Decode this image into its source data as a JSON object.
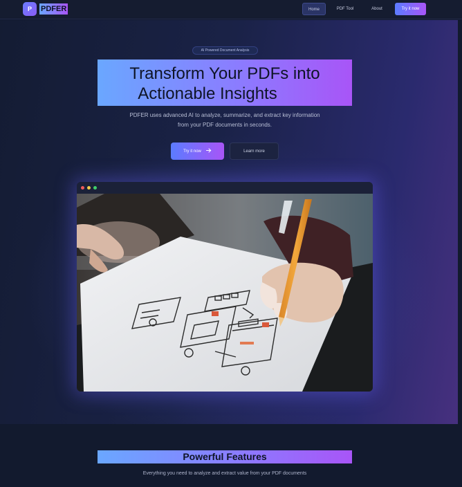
{
  "nav": {
    "logo_letter": "P",
    "brand": "PDFER",
    "links": [
      "Home",
      "PDF Tool",
      "About"
    ],
    "cta": "Try it now",
    "active": "Home"
  },
  "hero": {
    "pill": "AI Powered Document Analysis",
    "headline_line1": "Transform Your PDFs into",
    "headline_line2": "Actionable Insights",
    "subtext_line1": "PDFER uses advanced AI to analyze, summarize, and extract key information",
    "subtext_line2": "from your PDF documents in seconds.",
    "primary_button": "Try it now",
    "secondary_button": "Learn more"
  },
  "preview": {
    "image_alt": "Hand sketching UI wireframes on paper"
  },
  "features": {
    "title": "Powerful Features",
    "subtitle": "Everything you need to analyze and extract value from your PDF documents"
  },
  "colors": {
    "background": "#121a2e",
    "accent_start": "#6aa7ff",
    "accent_end": "#a855f7"
  },
  "icons": [
    "arrow-right-icon"
  ]
}
